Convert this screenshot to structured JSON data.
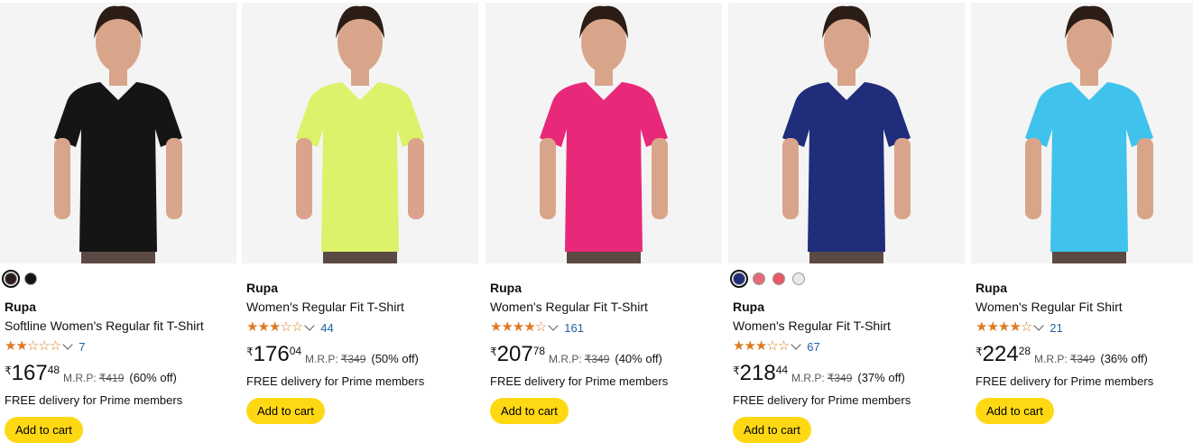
{
  "products": [
    {
      "brand": "Rupa",
      "title": "Softline Women's Regular fit T-Shirt",
      "stars": "★★☆☆☆",
      "rating_value": 2.5,
      "review_count": "7",
      "currency": "₹",
      "price_whole": "167",
      "price_fraction": "48",
      "mrp_label": "M.R.P:",
      "mrp_value": "₹419",
      "discount": "(60% off)",
      "delivery": "FREE delivery for Prime members",
      "button": "Add to cart",
      "shirt_color": "#151515",
      "swatches": [
        "#2a1d1a",
        "#151515"
      ]
    },
    {
      "brand": "Rupa",
      "title": "Women's Regular Fit T-Shirt",
      "stars": "★★★☆☆",
      "rating_value": 3.5,
      "review_count": "44",
      "currency": "₹",
      "price_whole": "176",
      "price_fraction": "04",
      "mrp_label": "M.R.P:",
      "mrp_value": "₹349",
      "discount": "(50% off)",
      "delivery": "FREE delivery for Prime members",
      "button": "Add to cart",
      "shirt_color": "#dcf26a",
      "swatches": []
    },
    {
      "brand": "Rupa",
      "title": "Women's Regular Fit T-Shirt",
      "stars": "★★★★☆",
      "rating_value": 4.0,
      "review_count": "161",
      "currency": "₹",
      "price_whole": "207",
      "price_fraction": "78",
      "mrp_label": "M.R.P:",
      "mrp_value": "₹349",
      "discount": "(40% off)",
      "delivery": "FREE delivery for Prime members",
      "button": "Add to cart",
      "shirt_color": "#e8297a",
      "swatches": []
    },
    {
      "brand": "Rupa",
      "title": "Women's Regular Fit T-Shirt",
      "stars": "★★★☆☆",
      "rating_value": 3.5,
      "review_count": "67",
      "currency": "₹",
      "price_whole": "218",
      "price_fraction": "44",
      "mrp_label": "M.R.P:",
      "mrp_value": "₹349",
      "discount": "(37% off)",
      "delivery": "FREE delivery for Prime members",
      "button": "Add to cart",
      "shirt_color": "#1f2d7a",
      "swatches": [
        "#1f2d7a",
        "#e76a78",
        "#ea5868",
        "#e8e8ee"
      ]
    },
    {
      "brand": "Rupa",
      "title": "Women's Regular Fit Shirt",
      "stars": "★★★★☆",
      "rating_value": 4.0,
      "review_count": "21",
      "currency": "₹",
      "price_whole": "224",
      "price_fraction": "28",
      "mrp_label": "M.R.P:",
      "mrp_value": "₹349",
      "discount": "(36% off)",
      "delivery": "FREE delivery for Prime members",
      "button": "Add to cart",
      "shirt_color": "#3fc3ec",
      "swatches": []
    }
  ]
}
